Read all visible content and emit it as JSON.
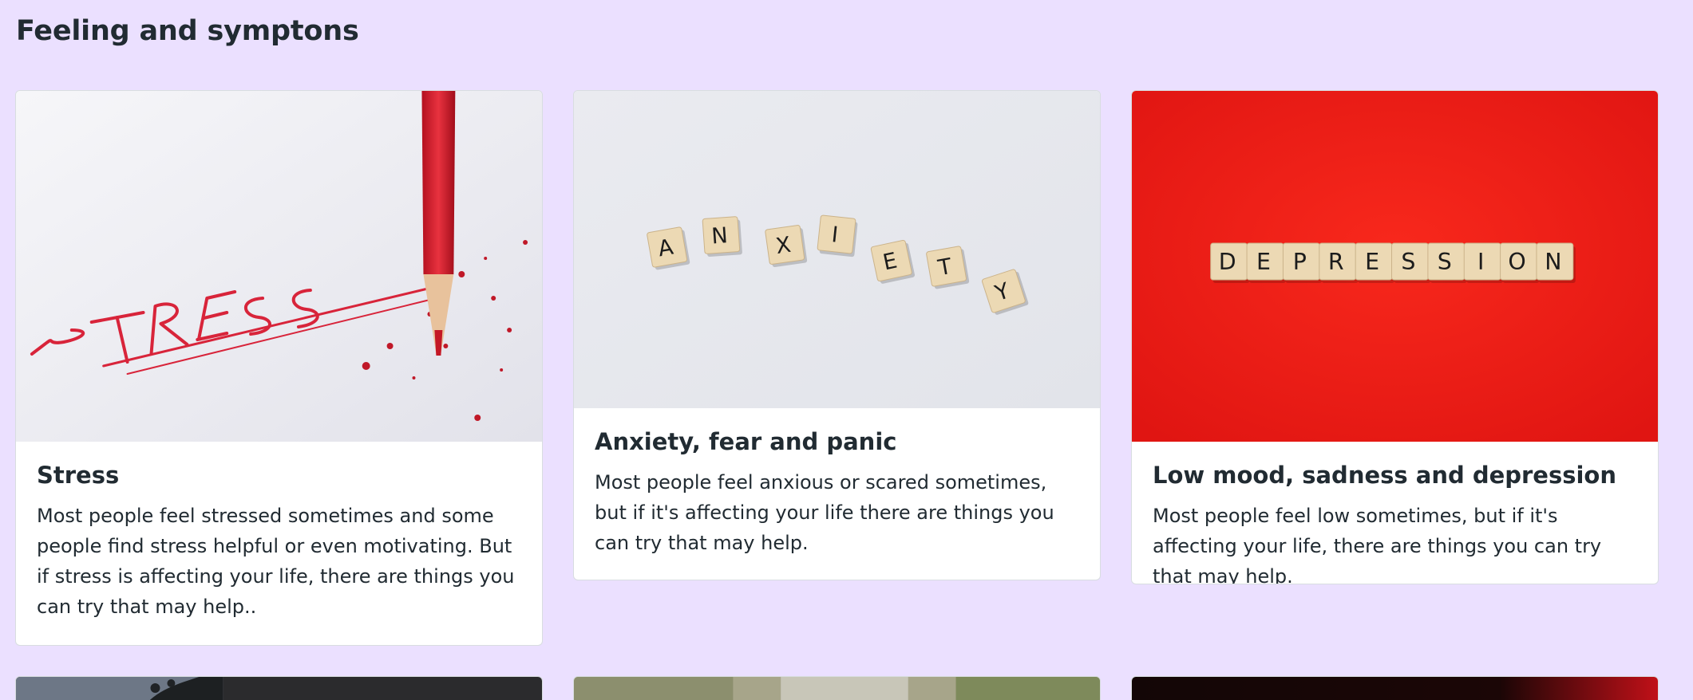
{
  "section": {
    "title": "Feeling and symptons"
  },
  "cards": [
    {
      "heading": "Stress",
      "description": "Most people feel stressed sometimes and some people find stress helpful or even motivating. But if stress is affecting your life, there are things you can try that may help..",
      "image_word": "STRESS"
    },
    {
      "heading": "Anxiety, fear and panic",
      "description": "Most people feel anxious or scared sometimes, but if it's affecting your life there are things you can try that may help.",
      "image_word": "ANXIETY"
    },
    {
      "heading": "Low mood, sadness and depression",
      "description": "Most people feel low sometimes, but if it's affecting your life, there are things you can try that may help.",
      "image_word": "DEPRESSION"
    }
  ],
  "colors": {
    "page_background": "#ebe0ff",
    "card_background": "#ffffff",
    "text": "#212b32",
    "stress_red": "#d8243a",
    "depression_red": "#f01a17",
    "tile": "#ecd9b4"
  }
}
